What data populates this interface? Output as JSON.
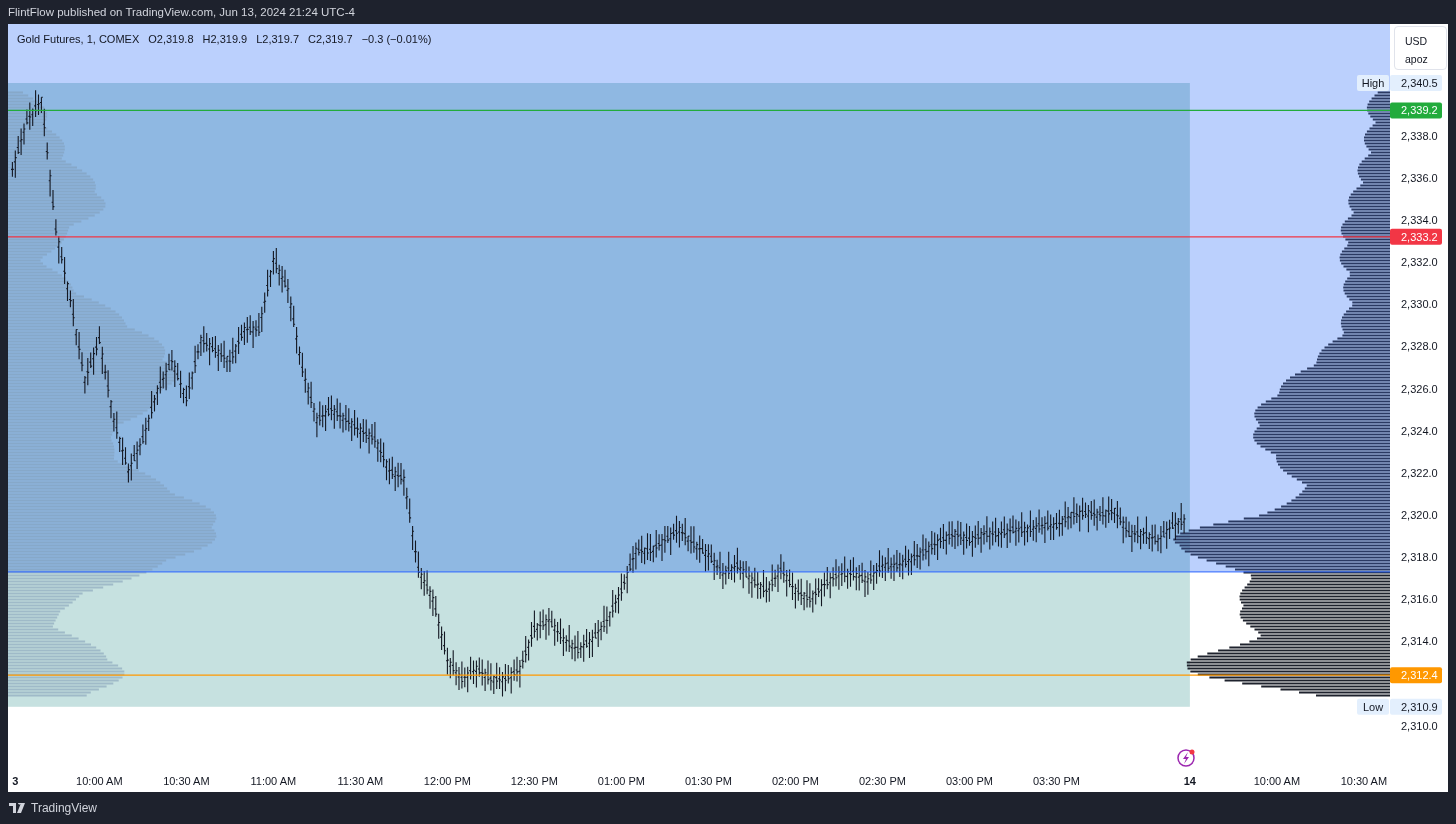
{
  "header": {
    "publisher": "FlintFlow published on TradingView.com, Jun 13, 2024 21:24 UTC-4"
  },
  "legend": {
    "symbol": "Gold Futures, 1, COMEX",
    "values": [
      "O2,319.8",
      "H2,319.9",
      "L2,319.7",
      "C2,319.7",
      "−0.3 (−0.01%)"
    ]
  },
  "scale_box": {
    "currency": "USD",
    "unit": "apoz"
  },
  "price_axis": {
    "labels": [
      "2,338.0",
      "2,336.0",
      "2,334.0",
      "2,332.0",
      "2,330.0",
      "2,328.0",
      "2,326.0",
      "2,324.0",
      "2,322.0",
      "2,320.0",
      "2,318.0",
      "2,316.0",
      "2,314.0",
      "2,310.0"
    ]
  },
  "levels": [
    {
      "label": "2,339.2",
      "color": "#22ab3c"
    },
    {
      "label": "2,333.2",
      "color": "#f23645"
    },
    {
      "label": "2,312.4",
      "color": "#ff9800"
    }
  ],
  "extremes": [
    {
      "tag": "High",
      "label": "2,340.5"
    },
    {
      "tag": "Low",
      "label": "2,310.9"
    }
  ],
  "time_axis": {
    "labels": [
      {
        "text": "3",
        "kind": "date"
      },
      {
        "text": "10:00 AM",
        "kind": "time"
      },
      {
        "text": "10:30 AM",
        "kind": "time"
      },
      {
        "text": "11:00 AM",
        "kind": "time"
      },
      {
        "text": "11:30 AM",
        "kind": "time"
      },
      {
        "text": "12:00 PM",
        "kind": "time"
      },
      {
        "text": "12:30 PM",
        "kind": "time"
      },
      {
        "text": "01:00 PM",
        "kind": "time"
      },
      {
        "text": "01:30 PM",
        "kind": "time"
      },
      {
        "text": "02:00 PM",
        "kind": "time"
      },
      {
        "text": "02:30 PM",
        "kind": "time"
      },
      {
        "text": "03:00 PM",
        "kind": "time"
      },
      {
        "text": "03:30 PM",
        "kind": "time"
      },
      {
        "text": "14",
        "kind": "date"
      },
      {
        "text": "10:00 AM",
        "kind": "time"
      },
      {
        "text": "10:30 AM",
        "kind": "time"
      }
    ]
  },
  "footer": {
    "brand": "TradingView"
  }
}
